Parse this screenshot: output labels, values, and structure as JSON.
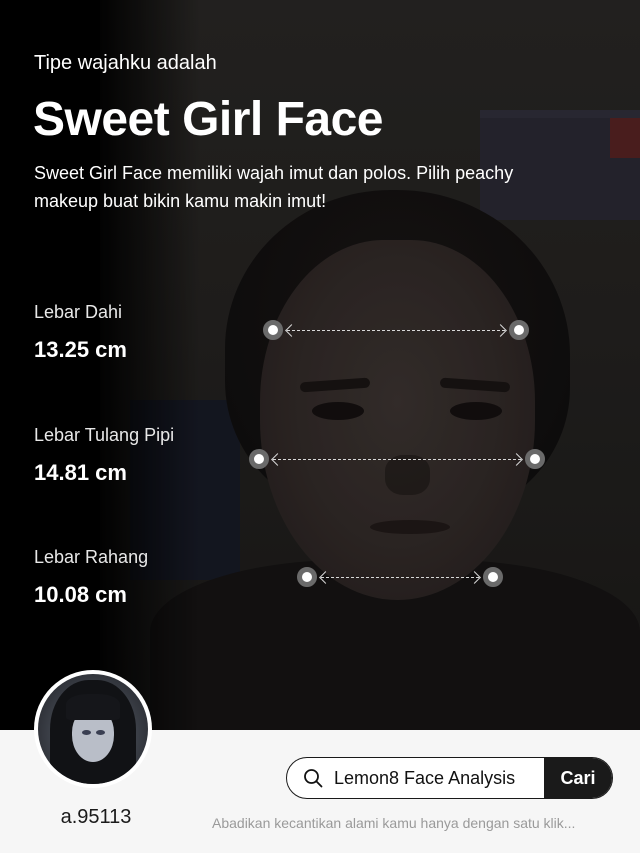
{
  "header": {
    "subtitle": "Tipe wajahku adalah",
    "title": "Sweet Girl Face",
    "description": "Sweet Girl Face memiliki wajah imut dan polos. Pilih peachy makeup buat bikin kamu makin imut!"
  },
  "metrics": [
    {
      "label": "Lebar Dahi",
      "value": "13.25 cm"
    },
    {
      "label": "Lebar Tulang Pipi",
      "value": "14.81 cm"
    },
    {
      "label": "Lebar Rahang",
      "value": "10.08 cm"
    }
  ],
  "profile": {
    "username": "a.95113"
  },
  "search": {
    "query": "Lemon8 Face Analysis",
    "button_label": "Cari"
  },
  "tagline": "Abadikan kecantikan alami kamu hanya dengan satu klik...",
  "icons": [
    "search-icon"
  ],
  "colors": {
    "background": "#000000",
    "bottom_bar": "#f6f6f6",
    "button": "#1a1a1a"
  }
}
